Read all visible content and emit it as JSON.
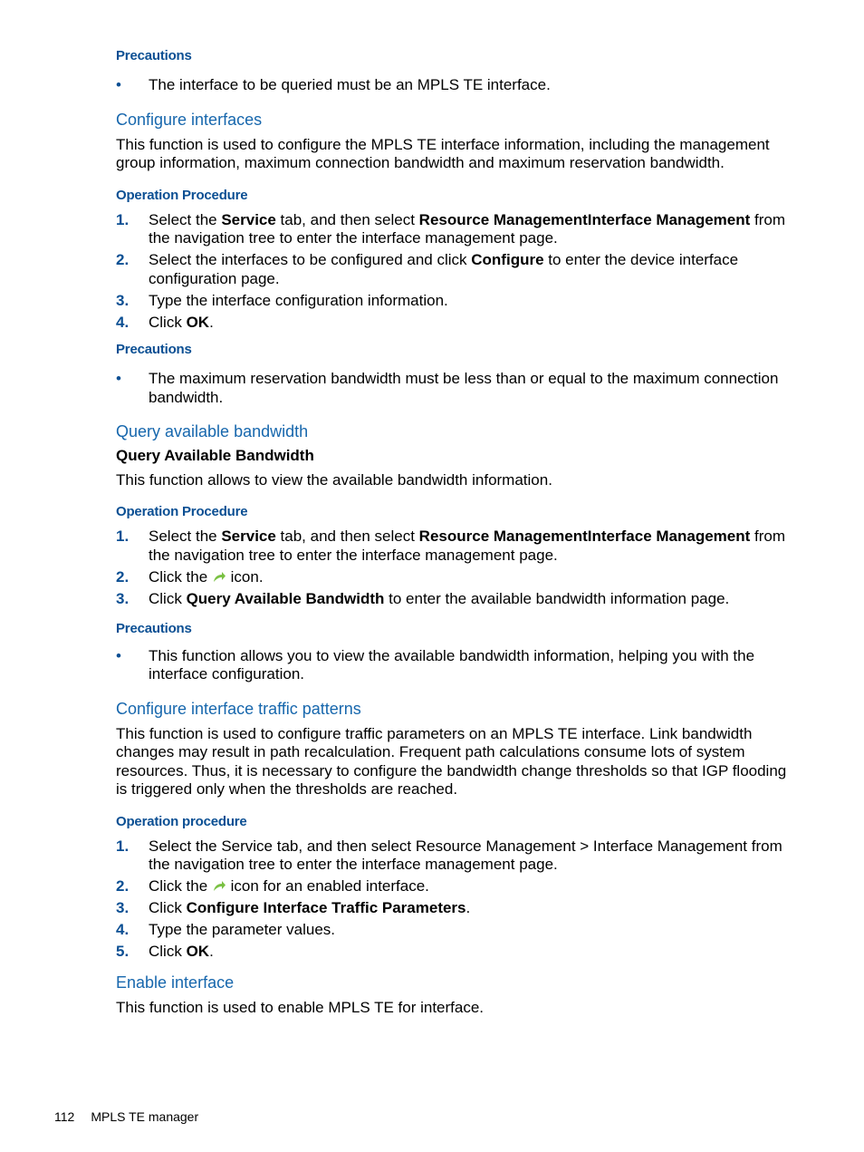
{
  "blocks": {
    "b1_heading": "Precautions",
    "b1_bullet": "The interface to be queried must be an MPLS TE interface.",
    "s1_title": "Configure interfaces",
    "s1_desc": "This function is used to configure the MPLS TE interface information, including the management group information, maximum connection bandwidth and maximum reservation bandwidth.",
    "s1_op_heading": "Operation Procedure",
    "s1_steps": {
      "n1": "1.",
      "n2": "2.",
      "n3": "3.",
      "n4": "4.",
      "s1_a": "Select the ",
      "s1_b": "Service",
      "s1_c": " tab, and then select ",
      "s1_d": "Resource ManagementInterface Management",
      "s1_e": " from the navigation tree to enter the interface management page.",
      "s2_a": "Select the interfaces to be configured and click ",
      "s2_b": "Configure",
      "s2_c": " to enter the device interface configuration page.",
      "s3": "Type the interface configuration information.",
      "s4_a": "Click ",
      "s4_b": "OK",
      "s4_c": "."
    },
    "s1_prec_heading": "Precautions",
    "s1_prec_bullet": "The maximum reservation bandwidth must be less than or equal to the maximum connection bandwidth.",
    "s2_title": "Query available bandwidth",
    "s2_bold": "Query Available Bandwidth",
    "s2_desc": "This function allows to view the available bandwidth information.",
    "s2_op_heading": "Operation Procedure",
    "s2_steps": {
      "n1": "1.",
      "n2": "2.",
      "n3": "3.",
      "s1_a": "Select the ",
      "s1_b": "Service",
      "s1_c": " tab, and then select ",
      "s1_d": "Resource ManagementInterface Management",
      "s1_e": " from the navigation tree to enter the interface management page.",
      "s2_a": "Click the ",
      "s2_b": " icon.",
      "s3_a": "Click ",
      "s3_b": "Query Available Bandwidth",
      "s3_c": " to enter the available bandwidth information page."
    },
    "s2_prec_heading": "Precautions",
    "s2_prec_bullet": "This function allows you to view the available bandwidth information, helping you with the interface configuration.",
    "s3_title": "Configure interface traffic patterns",
    "s3_desc": "This function is used to configure traffic parameters on an MPLS TE interface. Link bandwidth changes may result in path recalculation. Frequent path calculations consume lots of system resources. Thus, it is necessary to configure the bandwidth change thresholds so that IGP flooding is triggered only when the thresholds are reached.",
    "s3_op_heading": "Operation procedure",
    "s3_steps": {
      "n1": "1.",
      "n2": "2.",
      "n3": "3.",
      "n4": "4.",
      "n5": "5.",
      "s1": "Select the Service tab, and then select Resource Management > Interface Management from the navigation tree to enter the interface management page.",
      "s2_a": "Click the ",
      "s2_b": " icon for an enabled interface.",
      "s3_a": "Click ",
      "s3_b": "Configure Interface Traffic Parameters",
      "s3_c": ".",
      "s4": "Type the parameter values.",
      "s5_a": "Click ",
      "s5_b": "OK",
      "s5_c": "."
    },
    "s4_title": "Enable interface",
    "s4_desc": "This function is used to enable MPLS TE for interface."
  },
  "bullet_glyph": "•",
  "icons": {
    "arrow": "green-curved-arrow-icon"
  },
  "colors": {
    "heading": "#0b4f93",
    "section": "#1767ad",
    "arrow": "#7ac143"
  },
  "footer": {
    "page_number": "112",
    "chapter": "MPLS TE manager"
  }
}
